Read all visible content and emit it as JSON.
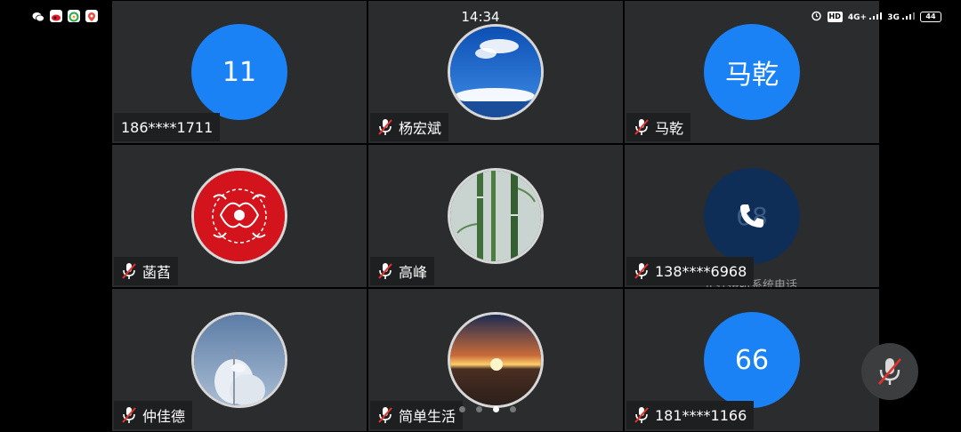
{
  "status_bar": {
    "time": "14:34",
    "hd_label": "HD",
    "network_1": "4G+",
    "network_2": "3G",
    "battery": "44",
    "left_icons": [
      "wechat-icon",
      "weibo-icon",
      "app-icon",
      "maps-icon"
    ]
  },
  "participants": [
    {
      "name": "186****1711",
      "avatar_text": "11",
      "avatar_type": "text",
      "muted": false
    },
    {
      "name": "杨宏斌",
      "avatar_type": "photo",
      "photo": "blue-sky",
      "muted": true
    },
    {
      "name": "马乾",
      "avatar_text": "马乾",
      "avatar_type": "text",
      "muted": true
    },
    {
      "name": "菡萏",
      "avatar_type": "photo",
      "photo": "red-papercut",
      "muted": true
    },
    {
      "name": "高峰",
      "avatar_type": "photo",
      "photo": "bamboo",
      "muted": true
    },
    {
      "name": "138****6968",
      "avatar_type": "calling",
      "ghost_text": "68",
      "status_text": "正在接听系统电话",
      "muted": true
    },
    {
      "name": "仲佳德",
      "avatar_type": "photo",
      "photo": "frost-tree",
      "muted": true
    },
    {
      "name": "简单生活",
      "avatar_type": "photo",
      "photo": "sunset",
      "muted": true
    },
    {
      "name": "181****1166",
      "avatar_text": "66",
      "avatar_type": "text",
      "muted": true
    }
  ],
  "pagination": {
    "total": 4,
    "current": 3
  },
  "controls": {
    "mic_button": "mic-muted-icon"
  },
  "colors": {
    "avatar_blue": "#1a82f5",
    "tile_bg": "#2b2c2e",
    "mute_red": "#e5322d"
  }
}
